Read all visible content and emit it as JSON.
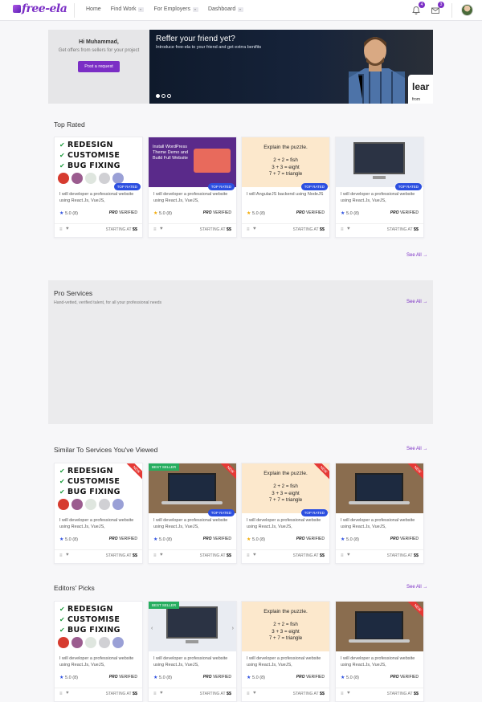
{
  "brand": {
    "logo": "free-ela",
    "accent": "#7b2ec5"
  },
  "nav": {
    "home": "Home",
    "find_work": "Find Work",
    "for_employers": "For Employers",
    "dashboard": "Dashboard"
  },
  "topbar": {
    "notifications_count": "4",
    "messages_count": "3"
  },
  "hero": {
    "greeting": "Hi Muhammad,",
    "subtitle": "Get offers from sellers for your project",
    "cta": "Post a request",
    "banner_title": "Reffer your friend yet?",
    "banner_desc": "Introduce free-ela to your friend and get extrra benifits",
    "banner_learn": "lear",
    "banner_small": "from"
  },
  "sections": {
    "top_rated": {
      "title": "Top Rated",
      "see_all": "See All →"
    },
    "pro": {
      "title": "Pro Services",
      "subtitle": "Hand-vetted, verified talent, for all your professional needs",
      "see_all": "See All →"
    },
    "similar": {
      "title": "Similar To Services You've Viewed",
      "see_all": "See All →"
    },
    "editors": {
      "title": "Editors' Picks",
      "see_all": "See All →"
    }
  },
  "thumb_text": {
    "redesign": [
      "REDESIGN",
      "CUSTOMISE",
      "BUG FIXING"
    ],
    "wp": "Install WordPress Theme Demo and Build Full Website",
    "puzzle_title": "Explain the puzzle.",
    "puzzle_lines": [
      "2 + 2 = fish",
      "3 + 3 = eight",
      "7 + 7 = triangle"
    ]
  },
  "tags": {
    "top_rated": "TOP RATED",
    "best_seller": "BEST SELLER",
    "new": "NEW"
  },
  "card_common": {
    "desc_react": "I will developer a professional website using React.Js, VueJS,",
    "desc_angular": "I will AngularJS backend using NodeJS",
    "rating": "5.0",
    "reviews": "(8)",
    "pro_label": "PRO",
    "verified": "VERIFIED",
    "starting": "STARTING AT",
    "price": "$$"
  }
}
